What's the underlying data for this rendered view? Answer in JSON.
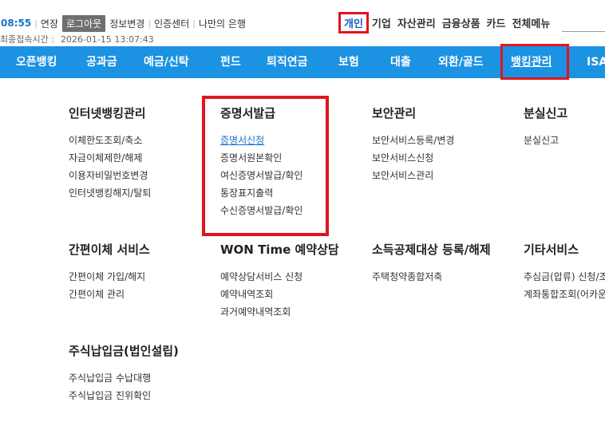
{
  "util": {
    "time": "08:55",
    "extend": "연장",
    "logout": "로그아웃",
    "info_change": "정보변경",
    "cert_center": "인증센터",
    "my_bank": "나만의 은행",
    "last_login_label": "최종접속시간 :",
    "last_login_time": "2026-01-15 13:07:43"
  },
  "top_nav": [
    "개인",
    "기업",
    "자산관리",
    "금융상품",
    "카드",
    "전체메뉴"
  ],
  "main_nav": [
    "오픈뱅킹",
    "공과금",
    "예금/신탁",
    "펀드",
    "퇴직연금",
    "보험",
    "대출",
    "외환/골드",
    "뱅킹관리",
    "ISA"
  ],
  "menu": {
    "internet_banking": {
      "title": "인터넷뱅킹관리",
      "items": [
        "이체한도조회/축소",
        "자금이체제한/해제",
        "이용자비밀번호변경",
        "인터넷뱅킹해지/탈퇴"
      ]
    },
    "certificate": {
      "title": "증명서발급",
      "items": [
        "증명서신청",
        "증명서원본확인",
        "여신증명서발급/확인",
        "통장표지출력",
        "수신증명서발급/확인"
      ]
    },
    "security": {
      "title": "보안관리",
      "items": [
        "보안서비스등록/변경",
        "보안서비스신청",
        "보안서비스관리"
      ]
    },
    "loss_report": {
      "title": "분실신고",
      "items": [
        "분실신고"
      ]
    },
    "easy_transfer": {
      "title": "간편이체 서비스",
      "items": [
        "간편이체 가입/해지",
        "간편이체 관리"
      ]
    },
    "won_time": {
      "title": "WON Time 예약상담",
      "items": [
        "예약상담서비스 신청",
        "예약내역조회",
        "과거예약내역조회"
      ]
    },
    "income_deduction": {
      "title": "소득공제대상 등록/해제",
      "items": [
        "주택청약종합저축"
      ]
    },
    "other": {
      "title": "기타서비스",
      "items": [
        "추심금(압류) 신청/조회",
        "계좌통합조회(어카운트인포)"
      ]
    },
    "stock_payment": {
      "title": "주식납입금(법인설립)",
      "items": [
        "주식납입금 수납대행",
        "주식납입금 진위확인"
      ]
    }
  }
}
